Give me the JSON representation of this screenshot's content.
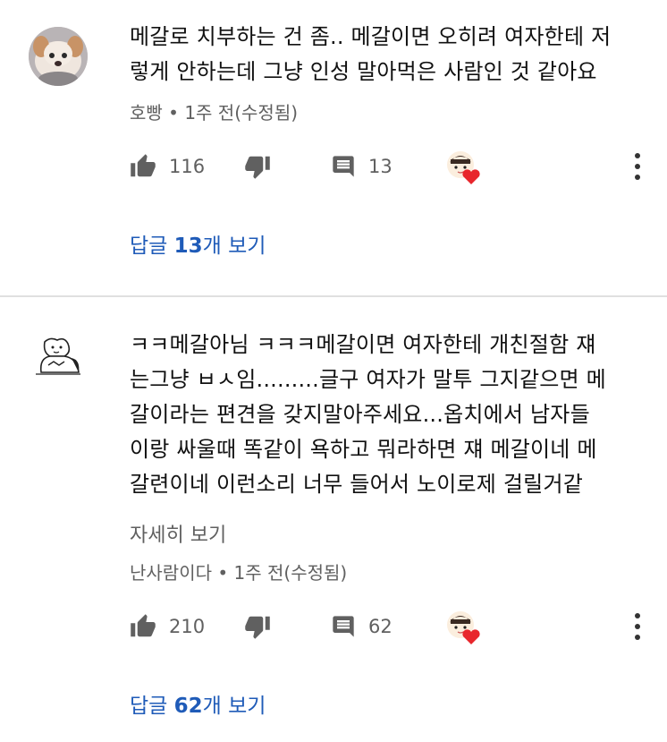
{
  "comments": [
    {
      "author": "호빵",
      "time": "1주 전(수정됨)",
      "text": "메갈로 치부하는 건 좀.. 메갈이면 오히려 여자한테 저\n렇게 안하는데 그냥 인성 말아먹은 사람인 것 같아요",
      "likes": "116",
      "replies_count": "13",
      "view_replies_prefix": "답글 ",
      "view_replies_count": "13",
      "view_replies_suffix": "개 보기",
      "avatar_icon": "dog-photo-avatar"
    },
    {
      "author": "난사람이다",
      "time": "1주 전(수정됨)",
      "text": "ㅋㅋ메갈아님 ㅋㅋㅋ메갈이면 여자한테 개친절함 쟤\n는그냥 ㅂㅅ임.........글구 여자가 말투 그지같으면 메\n갈이라는 편견을 갖지말아주세요...옵치에서 남자들\n이랑 싸울때 똑같이 욕하고 뭐라하면 쟤 메갈이네 메\n갈련이네 이런소리 너무 들어서 노이로제 걸릴거같",
      "read_more": "자세히 보기",
      "likes": "210",
      "replies_count": "62",
      "view_replies_prefix": "답글 ",
      "view_replies_count": "62",
      "view_replies_suffix": "개 보기",
      "avatar_icon": "cartoon-drawing-avatar"
    }
  ],
  "meta_separator": " • ",
  "colors": {
    "link_blue": "#1f5bb8",
    "meta_gray": "#606060",
    "icon_gray": "#606060",
    "heart_red": "#e8262c"
  }
}
